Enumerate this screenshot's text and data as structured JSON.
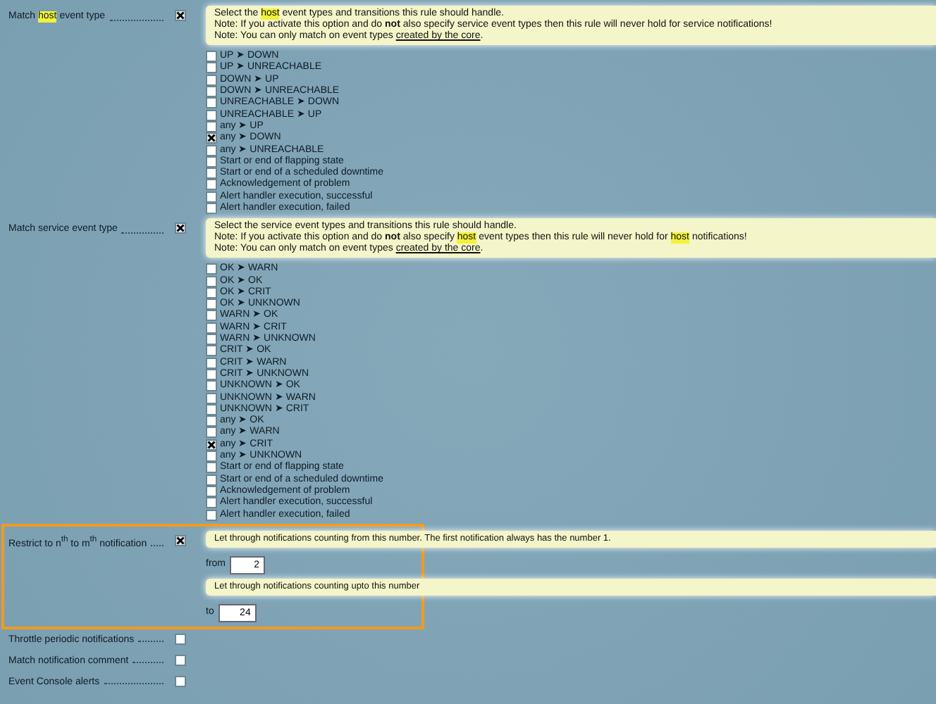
{
  "sections": [
    {
      "kind": "choices",
      "label": [
        {
          "kind": "plain",
          "text": "Match "
        },
        {
          "kind": "mark",
          "text": "host"
        },
        {
          "kind": "plain",
          "text": " event type"
        }
      ],
      "enabled": true,
      "help": [
        [
          {
            "kind": "plain",
            "text": "Select the "
          },
          {
            "kind": "mark",
            "text": "host"
          },
          {
            "kind": "plain",
            "text": " event types and transitions this rule should handle."
          }
        ],
        [
          {
            "kind": "plain",
            "text": "Note: If you activate this option and do "
          },
          {
            "kind": "bold",
            "text": "not"
          },
          {
            "kind": "plain",
            "text": " also specify service event types then this rule will never hold for service notifications!"
          }
        ],
        [
          {
            "kind": "plain",
            "text": "Note: You can only match on event types "
          },
          {
            "kind": "link",
            "text": "created by the core"
          },
          {
            "kind": "plain",
            "text": "."
          }
        ]
      ],
      "options": [
        {
          "label": "UP ➤ DOWN",
          "checked": false
        },
        {
          "label": "UP ➤ UNREACHABLE",
          "checked": false
        },
        {
          "label": "DOWN ➤ UP",
          "checked": false
        },
        {
          "label": "DOWN ➤ UNREACHABLE",
          "checked": false
        },
        {
          "label": "UNREACHABLE ➤ DOWN",
          "checked": false
        },
        {
          "label": "UNREACHABLE ➤ UP",
          "checked": false
        },
        {
          "label": "any ➤ UP",
          "checked": false
        },
        {
          "label": "any ➤ DOWN",
          "checked": true
        },
        {
          "label": "any ➤ UNREACHABLE",
          "checked": false
        },
        {
          "label": "Start or end of flapping state",
          "checked": false
        },
        {
          "label": "Start or end of a scheduled downtime",
          "checked": false
        },
        {
          "label": "Acknowledgement of problem",
          "checked": false
        },
        {
          "label": "Alert handler execution, successful",
          "checked": false
        },
        {
          "label": "Alert handler execution, failed",
          "checked": false
        }
      ]
    },
    {
      "kind": "choices",
      "label": [
        {
          "kind": "plain",
          "text": "Match service event type"
        }
      ],
      "enabled": true,
      "help": [
        [
          {
            "kind": "plain",
            "text": "Select the service event types and transitions this rule should handle."
          }
        ],
        [
          {
            "kind": "plain",
            "text": "Note: If you activate this option and do "
          },
          {
            "kind": "bold",
            "text": "not"
          },
          {
            "kind": "plain",
            "text": " also specify "
          },
          {
            "kind": "mark",
            "text": "host"
          },
          {
            "kind": "plain",
            "text": " event types then this rule will never hold for "
          },
          {
            "kind": "mark",
            "text": "host"
          },
          {
            "kind": "plain",
            "text": " notifications!"
          }
        ],
        [
          {
            "kind": "plain",
            "text": "Note: You can only match on event types "
          },
          {
            "kind": "link",
            "text": "created by the core"
          },
          {
            "kind": "plain",
            "text": "."
          }
        ]
      ],
      "options": [
        {
          "label": "OK ➤ WARN",
          "checked": false
        },
        {
          "label": "OK ➤ OK",
          "checked": false
        },
        {
          "label": "OK ➤ CRIT",
          "checked": false
        },
        {
          "label": "OK ➤ UNKNOWN",
          "checked": false
        },
        {
          "label": "WARN ➤ OK",
          "checked": false
        },
        {
          "label": "WARN ➤ CRIT",
          "checked": false
        },
        {
          "label": "WARN ➤ UNKNOWN",
          "checked": false
        },
        {
          "label": "CRIT ➤ OK",
          "checked": false
        },
        {
          "label": "CRIT ➤ WARN",
          "checked": false
        },
        {
          "label": "CRIT ➤ UNKNOWN",
          "checked": false
        },
        {
          "label": "UNKNOWN ➤ OK",
          "checked": false
        },
        {
          "label": "UNKNOWN ➤ WARN",
          "checked": false
        },
        {
          "label": "UNKNOWN ➤ CRIT",
          "checked": false
        },
        {
          "label": "any ➤ OK",
          "checked": false
        },
        {
          "label": "any ➤ WARN",
          "checked": false
        },
        {
          "label": "any ➤ CRIT",
          "checked": true
        },
        {
          "label": "any ➤ UNKNOWN",
          "checked": false
        },
        {
          "label": "Start or end of flapping state",
          "checked": false
        },
        {
          "label": "Start or end of a scheduled downtime",
          "checked": false
        },
        {
          "label": "Acknowledgement of problem",
          "checked": false
        },
        {
          "label": "Alert handler execution, successful",
          "checked": false
        },
        {
          "label": "Alert handler execution, failed",
          "checked": false
        }
      ]
    },
    {
      "kind": "range",
      "label": [
        {
          "kind": "plain",
          "text": "Restrict to n$^{th}$ to m$^{th}$ notification"
        }
      ],
      "enabled": true,
      "highlighted": true,
      "fields": [
        {
          "help": "Let through notifications counting from this number. The first notification always has the number 1.",
          "caption": "from",
          "value": "2"
        },
        {
          "help": "Let through notifications counting upto this number",
          "caption": "to",
          "value": "24"
        }
      ]
    },
    {
      "kind": "plain",
      "label": [
        {
          "kind": "plain",
          "text": "Throttle periodic notifications"
        }
      ],
      "enabled": false
    },
    {
      "kind": "plain",
      "label": [
        {
          "kind": "plain",
          "text": "Match notification comment"
        }
      ],
      "enabled": false
    },
    {
      "kind": "plain",
      "label": [
        {
          "kind": "plain",
          "text": "Event Console alerts"
        }
      ],
      "enabled": false
    }
  ]
}
